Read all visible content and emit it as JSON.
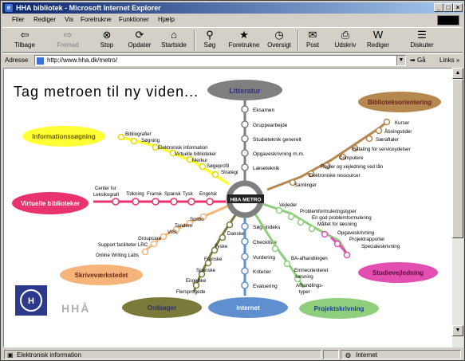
{
  "window": {
    "title": "HHA bibliotek - Microsoft Internet Explorer"
  },
  "menu": [
    "Filer",
    "Rediger",
    "Vis",
    "Foretrukne",
    "Funktioner",
    "Hjælp"
  ],
  "toolbar": {
    "back": "Tilbage",
    "forward": "Fremad",
    "stop": "Stop",
    "refresh": "Opdater",
    "home": "Startside",
    "search": "Søg",
    "favorites": "Foretrukne",
    "history": "Oversigt",
    "mail": "Post",
    "print": "Udskriv",
    "edit": "Rediger",
    "discuss": "Diskuter"
  },
  "address": {
    "label": "Adresse",
    "url": "http://www.hha.dk/metro/",
    "go": "Gå",
    "links": "Links"
  },
  "page": {
    "heading": "Tag metroen til ny viden...",
    "hub": "HBA METRO",
    "bubbles": {
      "litteratur": "Litteratur",
      "biblioteksorientering": "Biblioteksorientering",
      "informationssogning": "Informationssøgning",
      "virtuelle": "Virtuelle biblioteker",
      "skrivevaerkstedet": "Skriveværkstedet",
      "studievejledning": "Studievejledning",
      "ordboger": "Ordbøger",
      "internet": "Internet",
      "projektskrivning": "Projektskrivning"
    },
    "lines": {
      "litteratur": [
        "Eksamen",
        "Gruppearbejde",
        "Studieteknik generelt",
        "Opgaveskrivning m.m.",
        "Læseteknik"
      ],
      "biblioteksorientering": [
        "Kurser",
        "Åbningstider",
        "Særaftaler",
        "Betaling for serviceydelser",
        "Computere",
        "Regler og vejledning ved lån",
        "Elektroniske ressourcer",
        "Samlinger"
      ],
      "informationssogning": [
        "Bibliografier",
        "Søgning",
        "Elektronisk information",
        "Virtuelle biblioteker",
        "Merkur",
        "Søgeprofil",
        "Strategi"
      ],
      "virtuelle": [
        "Center for Leksikografi",
        "Tolkning",
        "Fransk",
        "Spansk",
        "Tysk",
        "Engelsk"
      ],
      "skrivevaerkstedet": [
        "Scribo",
        "Tandem",
        "VISL",
        "Groupcare",
        "Support faciliteter LRC",
        "Online Writing Labs"
      ],
      "ordboger": [
        "Danske",
        "Tyske",
        "Franske",
        "Spanske",
        "Engelske",
        "Flersprogede"
      ],
      "internet": [
        "Søgeindeks",
        "Checkliste",
        "Vurdering",
        "Kriterier",
        "Evaluering"
      ],
      "projektskrivning": [
        "BA-afhandlingen",
        "Emneorienteret læsning",
        "Afhandlings-typer"
      ],
      "studievejledning": [
        "Vejleder",
        "Problemformuleringstyper",
        "En god problemformulering",
        "Måltet for læsning",
        "Opgaveskrivning",
        "Projektrapporter",
        "Specialeskrivning"
      ]
    },
    "logo_text": "HHÅ"
  },
  "status": {
    "text": "Elektronisk information",
    "zone": "Internet"
  },
  "colors": {
    "litteratur": "#7f7f7f",
    "biblioteksorientering": "#b58850",
    "informationssogning": "#ffff33",
    "virtuelle": "#e8336e",
    "skrivevaerkstedet": "#f7b47a",
    "ordboger": "#7a7a3a",
    "internet": "#5f8fce",
    "projektskrivning": "#8fce7c",
    "studievejledning": "#e24fb0"
  }
}
